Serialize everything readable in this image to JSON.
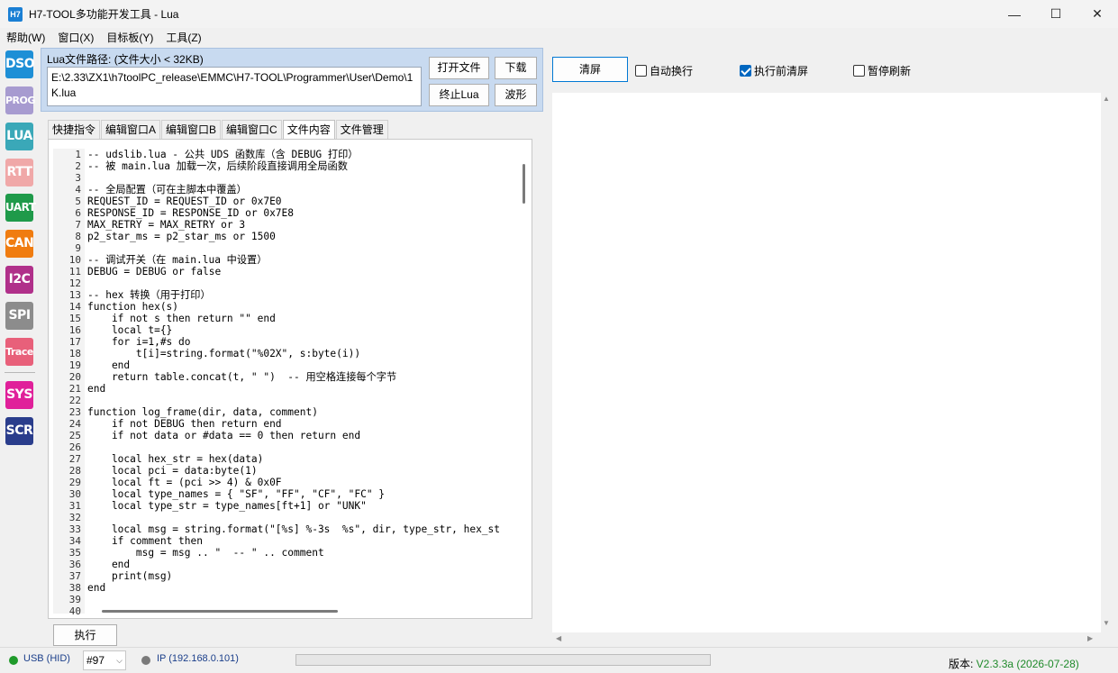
{
  "window": {
    "icon_text": "H7",
    "title": "H7-TOOL多功能开发工具 - Lua",
    "minimize": "—",
    "maximize": "☐",
    "close": "✕"
  },
  "menu": [
    "帮助(W)",
    "窗口(X)",
    "目标板(Y)",
    "工具(Z)"
  ],
  "sidebar": [
    {
      "label": "DSO",
      "color": "#1e8fd6"
    },
    {
      "label": "PROG",
      "color": "#a79bd0"
    },
    {
      "label": "LUA",
      "color": "#3aa8b8"
    },
    {
      "label": "RTT",
      "color": "#f0a8a8"
    },
    {
      "label": "UART",
      "color": "#1f9a4a"
    },
    {
      "label": "CAN",
      "color": "#f07c10"
    },
    {
      "label": "I2C",
      "color": "#b0308a"
    },
    {
      "label": "SPI",
      "color": "#8c8c8c"
    },
    {
      "label": "Trace",
      "color": "#e8607a"
    },
    {
      "label": "SYS",
      "color": "#e0209a"
    },
    {
      "label": "SCR",
      "color": "#2a3d8c"
    }
  ],
  "lua_panel": {
    "label": "Lua文件路径: (文件大小 < 32KB)",
    "path": "E:\\2.33\\ZX1\\h7toolPC_release\\EMMC\\H7-TOOL\\Programmer\\User\\Demo\\1K.lua",
    "open_file": "打开文件",
    "download": "下载",
    "stop_lua": "终止Lua",
    "waveform": "波形"
  },
  "tabs": [
    "快捷指令",
    "编辑窗口A",
    "编辑窗口B",
    "编辑窗口C",
    "文件内容",
    "文件管理"
  ],
  "active_tab": 4,
  "code_lines": [
    "-- udslib.lua - 公共 UDS 函数库（含 DEBUG 打印）",
    "-- 被 main.lua 加载一次，后续阶段直接调用全局函数",
    "",
    "-- 全局配置（可在主脚本中覆盖）",
    "REQUEST_ID = REQUEST_ID or 0x7E0",
    "RESPONSE_ID = RESPONSE_ID or 0x7E8",
    "MAX_RETRY = MAX_RETRY or 3",
    "p2_star_ms = p2_star_ms or 1500",
    "",
    "-- 调试开关（在 main.lua 中设置）",
    "DEBUG = DEBUG or false",
    "",
    "-- hex 转换（用于打印）",
    "function hex(s)",
    "    if not s then return \"\" end",
    "    local t={}",
    "    for i=1,#s do",
    "        t[i]=string.format(\"%02X\", s:byte(i))",
    "    end",
    "    return table.concat(t, \" \")  -- 用空格连接每个字节",
    "end",
    "",
    "function log_frame(dir, data, comment)",
    "    if not DEBUG then return end",
    "    if not data or #data == 0 then return end",
    "",
    "    local hex_str = hex(data)",
    "    local pci = data:byte(1)",
    "    local ft = (pci >> 4) & 0x0F",
    "    local type_names = { \"SF\", \"FF\", \"CF\", \"FC\" }",
    "    local type_str = type_names[ft+1] or \"UNK\"",
    "",
    "    local msg = string.format(\"[%s] %-3s  %s\", dir, type_str, hex_st",
    "    if comment then",
    "        msg = msg .. \"  -- \" .. comment",
    "    end",
    "    print(msg)",
    "end",
    "",
    ""
  ],
  "line_numbers": [
    "1",
    "2",
    "3",
    "4",
    "5",
    "6",
    "7",
    "8",
    "9",
    "10",
    "11",
    "12",
    "13",
    "14",
    "15",
    "16",
    "17",
    "18",
    "19",
    "20",
    "21",
    "22",
    "23",
    "24",
    "25",
    "26",
    "27",
    "28",
    "29",
    "30",
    "31",
    "32",
    "33",
    "34",
    "35",
    "36",
    "37",
    "38",
    "39",
    "40"
  ],
  "execute": "执行",
  "output_toolbar": {
    "clear": "清屏",
    "auto_wrap": {
      "label": "自动换行",
      "checked": false
    },
    "clear_before_run": {
      "label": "执行前清屏",
      "checked": true
    },
    "pause_refresh": {
      "label": "暂停刷新",
      "checked": false
    }
  },
  "status": {
    "usb": "USB (HID)",
    "usb_color": "#1f9a2a",
    "device": "#97",
    "ip": "IP (192.168.0.101)",
    "ip_color": "#7a7a7a",
    "version_label": "版本: ",
    "version_value": "V2.3.3a (2026-07-28)",
    "version_color": "#1f8a2a"
  }
}
